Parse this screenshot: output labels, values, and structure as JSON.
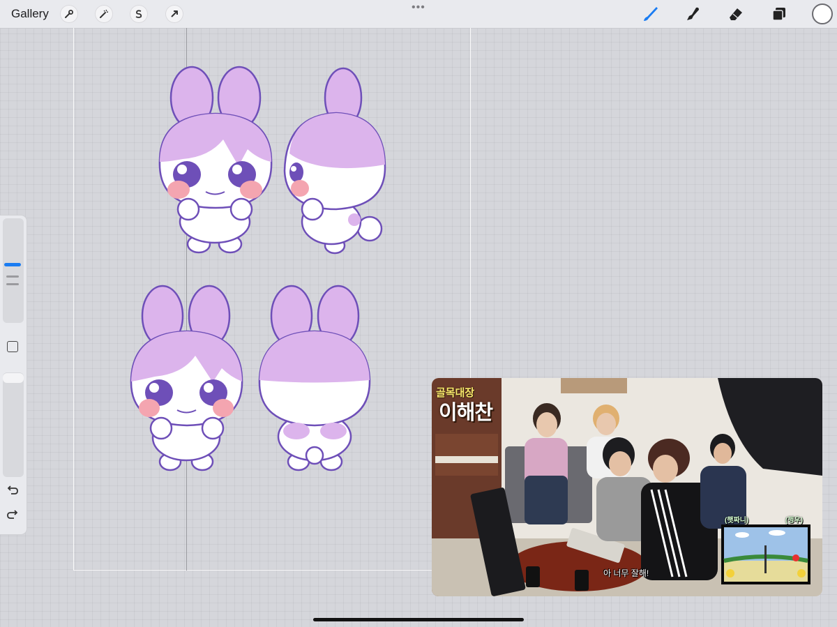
{
  "toolbar": {
    "gallery_label": "Gallery",
    "left_tools": [
      "wrench-icon",
      "magic-wand-icon",
      "selection-s-icon",
      "transform-arrow-icon"
    ],
    "more_label": "•••",
    "right_tools": [
      "brush-icon",
      "smudge-icon",
      "eraser-icon",
      "layers-icon"
    ],
    "active_tool": "brush-icon",
    "accent_color": "#1a7cf2",
    "current_color": "#ffffff"
  },
  "sidebar": {
    "brush_size_level": 0.55,
    "opacity_level": 1.0
  },
  "artwork": {
    "fill_ears": "#dcb4ec",
    "outline": "#6e4fb8",
    "cheeks": "#f4a5b0",
    "eyes": "#5b3ea8"
  },
  "video": {
    "show_title_top": "골목대장",
    "show_title_main": "이해찬",
    "caption_left": "(햇짜니)",
    "caption_right": "(쩡우)",
    "subtitle": "아 너무 잘해!"
  }
}
